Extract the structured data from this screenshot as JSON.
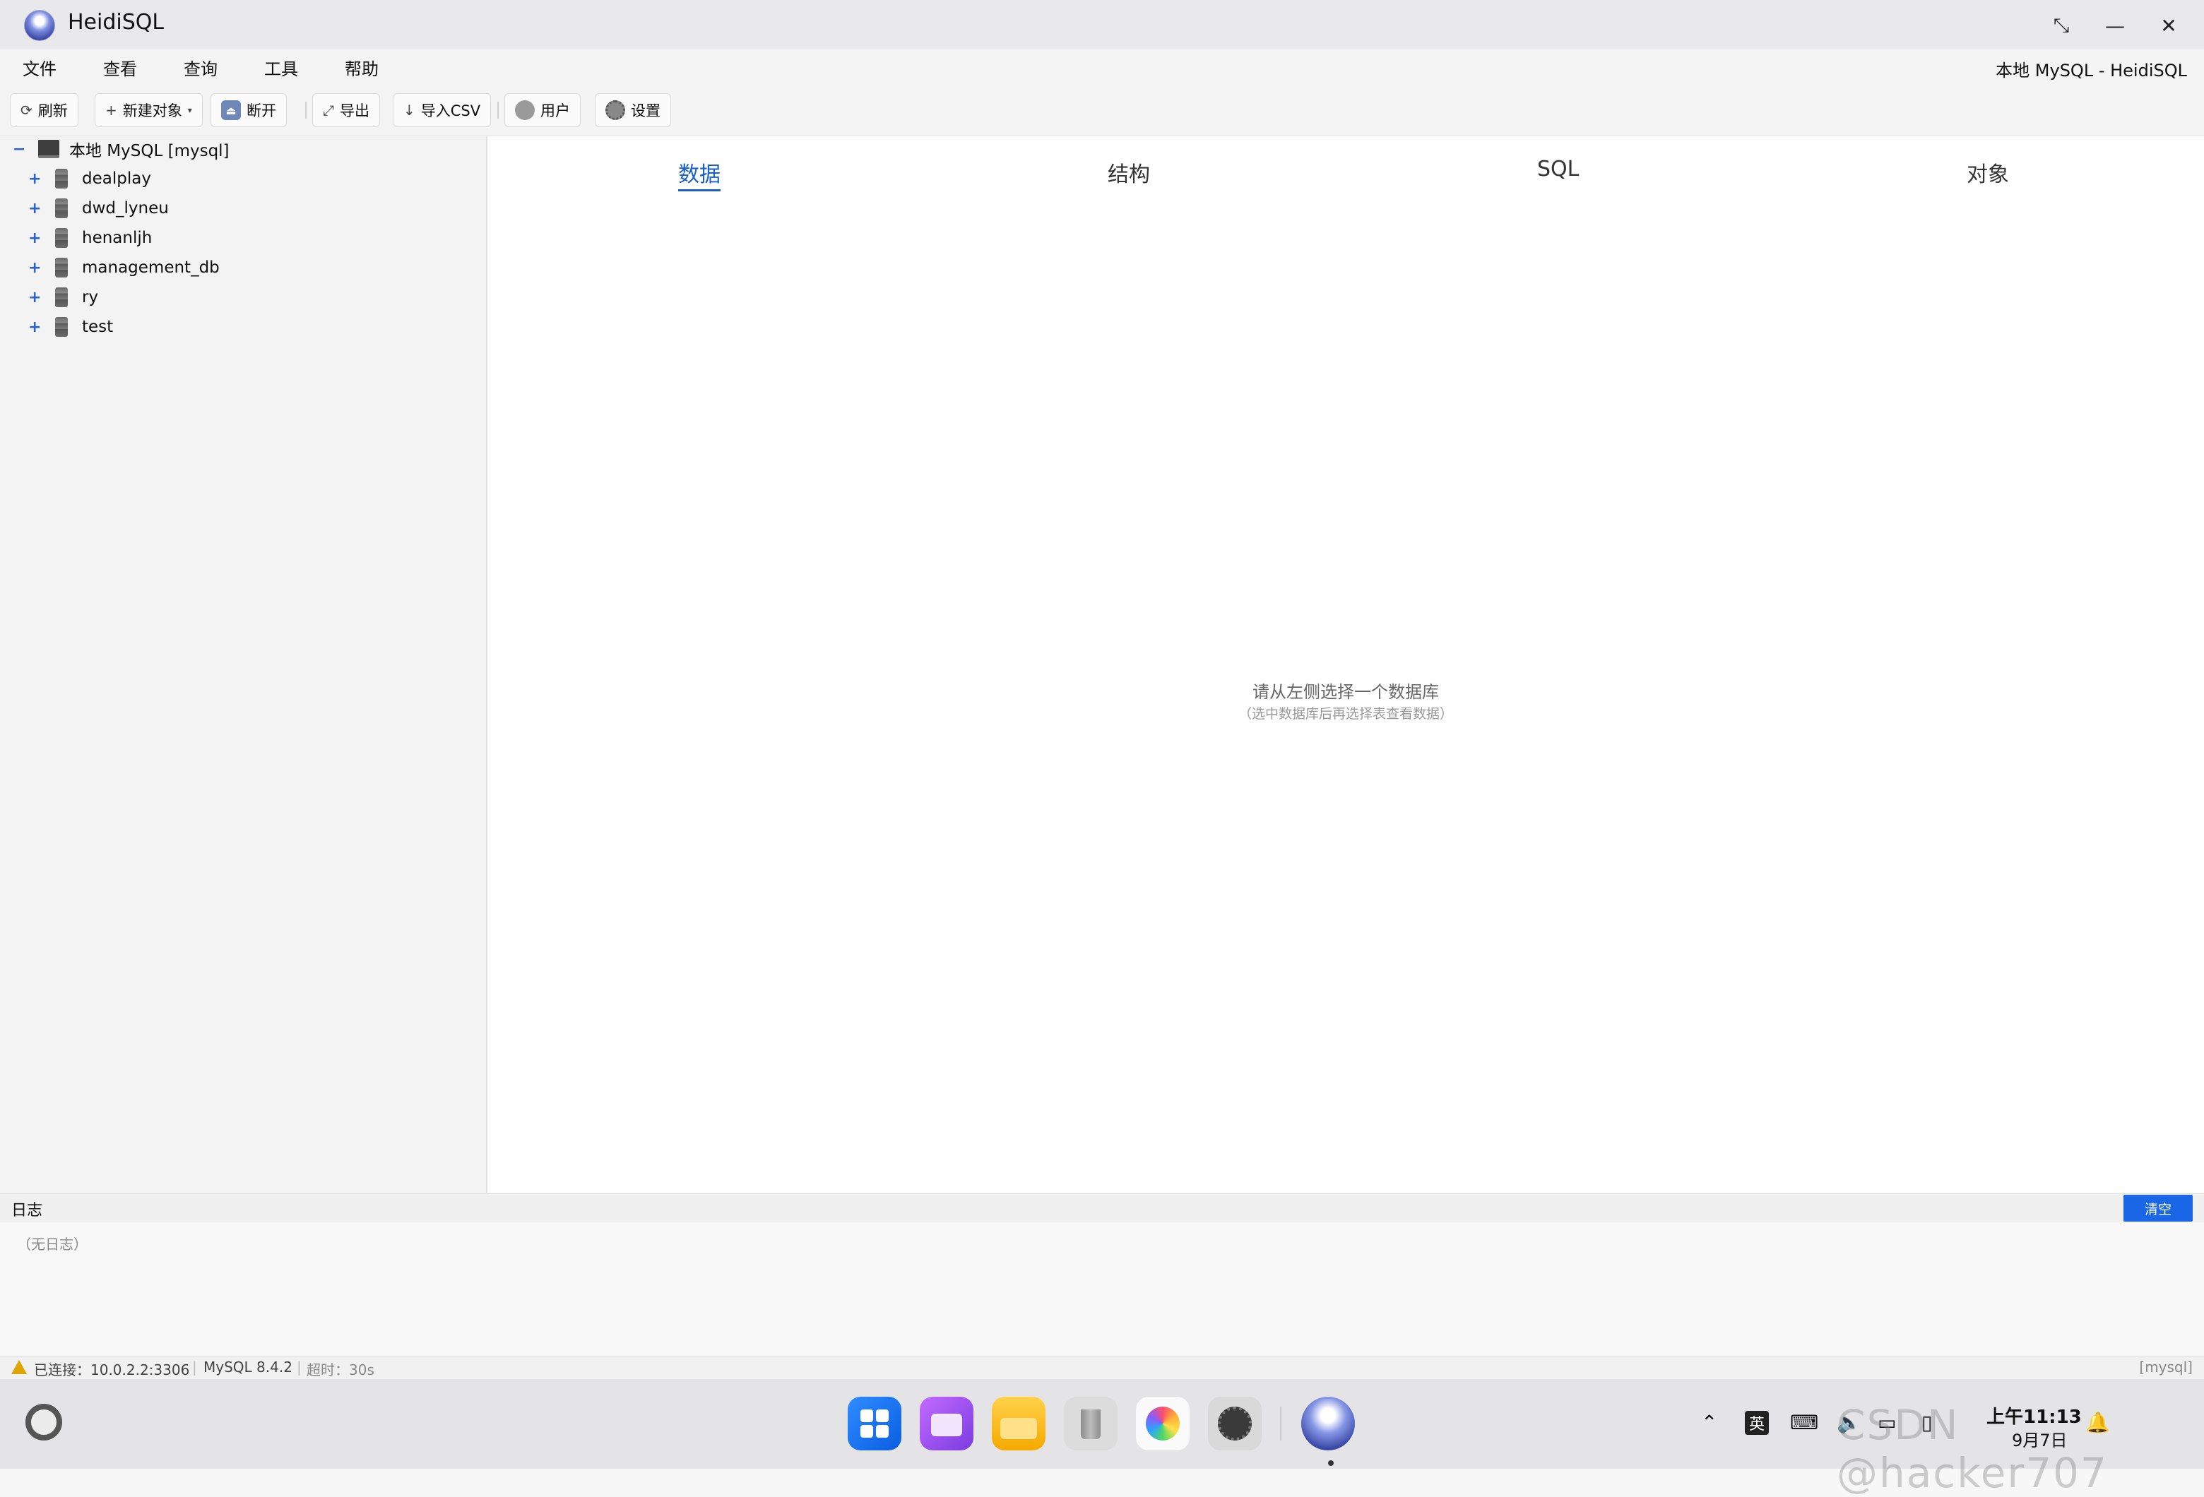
{
  "app": {
    "title": "HeidiSQL",
    "window_title_right": "本地 MySQL - HeidiSQL"
  },
  "menu": [
    "文件",
    "查看",
    "查询",
    "工具",
    "帮助"
  ],
  "toolbar": {
    "refresh": "刷新",
    "new_object": "新建对象",
    "disconnect": "断开",
    "export": "导出",
    "import_csv": "导入CSV",
    "users": "用户",
    "settings": "设置"
  },
  "tree": {
    "root_toggle": "−",
    "root_label": "本地 MySQL [mysql]",
    "expander": "+",
    "databases": [
      "dealplay",
      "dwd_lyneu",
      "henanljh",
      "management_db",
      "ry",
      "test"
    ]
  },
  "tabs": [
    "数据",
    "结构",
    "SQL",
    "对象"
  ],
  "main": {
    "empty_message": "请从左侧选择一个数据库",
    "empty_hint": "（选中数据库后再选择表查看数据）"
  },
  "log": {
    "title": "日志",
    "clear_label": "清空",
    "empty_text": "（无日志）"
  },
  "status": {
    "connected": "已连接：10.0.2.2:3306",
    "version": "MySQL 8.4.2",
    "timeout": "超时：30s",
    "right": "[mysql]"
  },
  "taskbar": {
    "tray_lang": "英",
    "time": "上午11:13",
    "date": "9月7日",
    "watermark": "CSDN @hacker707",
    "dock_icons": [
      "launcher-icon",
      "multitask-icon",
      "files-icon",
      "trash-icon",
      "photos-icon",
      "settings-icon",
      "heidisql-icon"
    ]
  },
  "colors": {
    "accent": "#1a5fd0",
    "clear_button": "#1967e6"
  }
}
